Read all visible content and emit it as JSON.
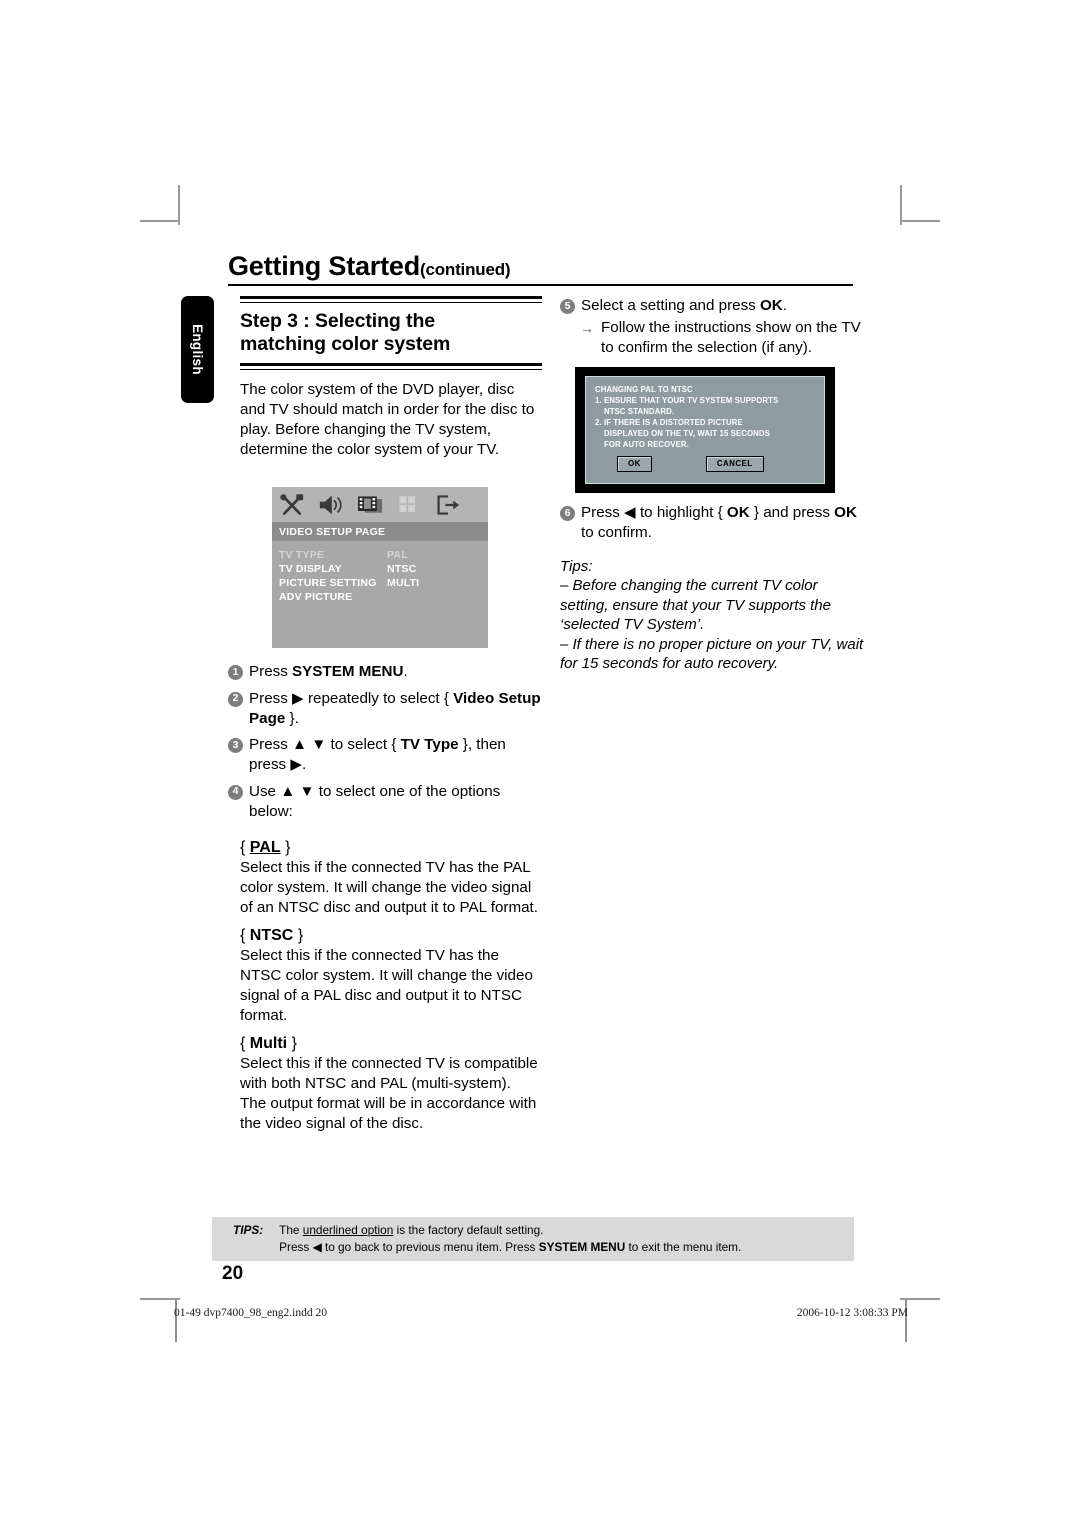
{
  "header": {
    "chapter_title": "Getting Started",
    "chapter_suffix": "(continued)"
  },
  "language_tab": {
    "label": "English"
  },
  "left_column": {
    "step_heading_line1": "Step 3 : Selecting the",
    "step_heading_line2": "matching color system",
    "intro_paragraph": "The color system of the DVD player, disc and TV should match in order for the disc to play. Before changing the TV system, determine the color system of your TV.",
    "steps": [
      {
        "num": "1",
        "text_html": "Press <b>SYSTEM MENU</b>."
      },
      {
        "num": "2",
        "text_html": "Press ▶ repeatedly to select { <b>Video Setup Page</b> }."
      },
      {
        "num": "3",
        "text_html": "Press ▲ ▼ to select { <b>TV Type</b> }, then press ▶."
      },
      {
        "num": "4",
        "text_html": "Use ▲ ▼ to select one of the options below:"
      }
    ],
    "options": [
      {
        "open_brace": "{",
        "key": "PAL",
        "close_brace": "}",
        "underlined": true,
        "body": "Select this if the connected TV has the PAL color system. It will change the video signal of an NTSC disc and output it to PAL format."
      },
      {
        "open_brace": "{",
        "key": "NTSC",
        "close_brace": "}",
        "underlined": false,
        "body": "Select this if the connected TV has the NTSC color system. It will change the video signal of a PAL disc and output it to NTSC format."
      },
      {
        "open_brace": "{",
        "key": "Multi",
        "close_brace": "}",
        "underlined": false,
        "body": "Select this if the connected TV is compatible with both NTSC and PAL (multi-system). The output format will be in accordance with the video signal of the disc."
      }
    ]
  },
  "osd_setup_page": {
    "title": "VIDEO SETUP PAGE",
    "icons": [
      "tools-icon",
      "speaker-icon",
      "film-icon",
      "grid-icon",
      "exit-icon"
    ],
    "rows": [
      {
        "label": "TV TYPE",
        "value": "PAL",
        "selected": true
      },
      {
        "label": "TV DISPLAY",
        "value": "NTSC",
        "selected": false
      },
      {
        "label": "PICTURE SETTING",
        "value": "MULTI",
        "selected": false
      },
      {
        "label": "ADV PICTURE",
        "value": "",
        "selected": false
      }
    ],
    "colors": {
      "panel": "#a8a8a8",
      "iconbar": "#b4b4b4",
      "titlebar": "#8b8b8b",
      "text": "#ffffff",
      "selected_text": "#d4d4d4"
    }
  },
  "right_column": {
    "step5": {
      "num": "5",
      "text_html": "Select a setting and press <b>OK</b>."
    },
    "step5_arrow": {
      "glyph": "→",
      "line1": "Follow the instructions show on the",
      "line2": "TV to confirm the selection (if any)."
    },
    "step6": {
      "num": "6",
      "text_html": "Press ◀ to highlight { <b>OK</b> } and press <b>OK</b> to confirm."
    },
    "tips_label": "Tips:",
    "tips": [
      "– Before changing the current TV color setting, ensure that your TV supports the ‘selected TV System’.",
      "– If there is no proper picture on your TV, wait for 15 seconds for auto recovery."
    ]
  },
  "tv_dialog": {
    "line1": "CHANGING PAL TO NTSC",
    "line2": "1. ENSURE THAT YOUR TV SYSTEM SUPPORTS",
    "line3": "NTSC STANDARD.",
    "line4": "2. IF THERE IS A DISTORTED PICTURE",
    "line5": "DISPLAYED ON THE TV, WAIT 15 SECONDS",
    "line6": "FOR AUTO RECOVER.",
    "ok_button": "OK",
    "cancel_button": "CANCEL",
    "screen_color": "#8e9ca0",
    "bezel_color": "#000000"
  },
  "tips_bar": {
    "label": "TIPS:",
    "line1_pre": "The ",
    "line1_underlined": "underlined option",
    "line1_post": " is the factory default setting.",
    "line2_pre": "Press ◀ to go back to previous menu item. Press ",
    "line2_bold": "SYSTEM MENU",
    "line2_post": " to exit the menu item."
  },
  "page_number": "20",
  "print_footer": {
    "file_info": "01-49 dvp7400_98_eng2.indd   20",
    "timestamp": "2006-10-12   3:08:33 PM"
  }
}
